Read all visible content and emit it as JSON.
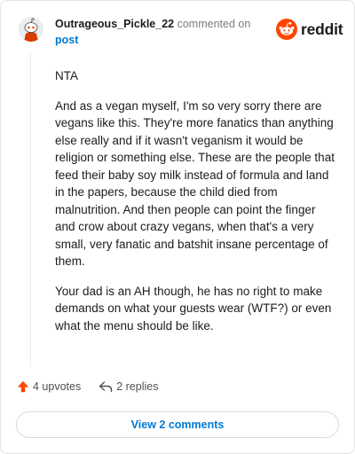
{
  "comment": {
    "username": "Outrageous_Pickle_22",
    "commented_on": "commented on",
    "post_link": "post",
    "paragraphs": [
      "NTA",
      "And as a vegan myself, I'm so very sorry there are vegans like this. They're more fanatics than anything else really and if it wasn't veganism it would be religion or something else. These are the people that feed their baby soy milk instead of formula and land in the papers, because the child died from malnutrition. And then people can point the finger and crow about crazy vegans, when that's a very small, very fanatic and batshit insane percentage of them.",
      "Your dad is an AH though, he has no right to make demands on what your guests wear (WTF?) or even what the menu should be like."
    ]
  },
  "brand": {
    "logo_text": "reddit",
    "logo_icon": "reddit-snoo-icon",
    "accent_color": "#ff4500"
  },
  "actions": {
    "upvotes_label": "4 upvotes",
    "replies_label": "2 replies",
    "upvote_icon": "upvote-arrow-icon",
    "reply_icon": "reply-arrow-icon"
  },
  "view_comments_label": "View 2 comments",
  "colors": {
    "link": "#0079d3",
    "upvote": "#ff4500"
  }
}
